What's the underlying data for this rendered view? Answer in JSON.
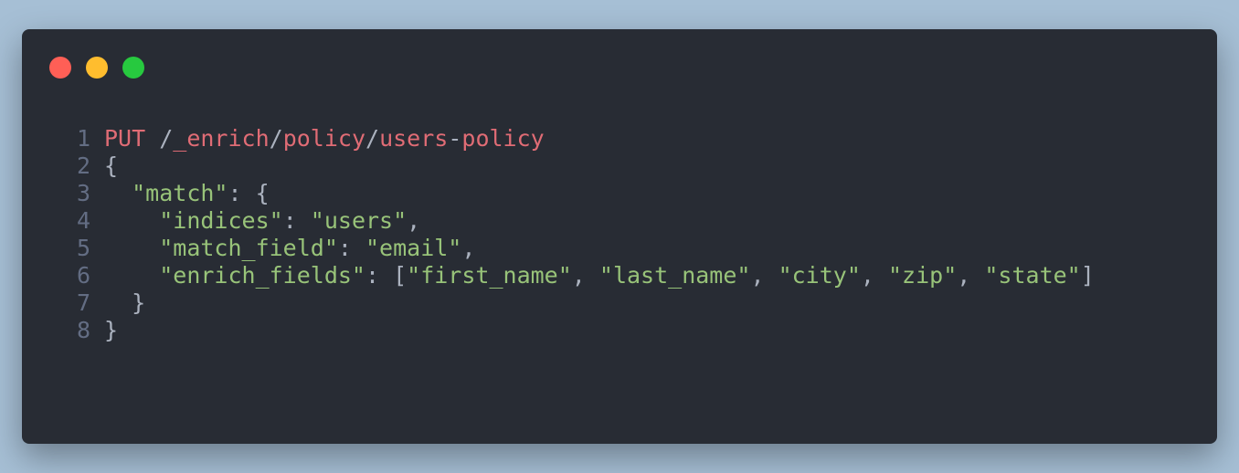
{
  "window_controls": {
    "close": "close",
    "minimize": "minimize",
    "maximize": "maximize"
  },
  "code": {
    "lines": [
      {
        "number": "1",
        "tokens": [
          {
            "text": "PUT",
            "kind": "kw"
          },
          {
            "text": " /",
            "kind": "pl"
          },
          {
            "text": "_enrich",
            "kind": "kw"
          },
          {
            "text": "/",
            "kind": "pl"
          },
          {
            "text": "policy",
            "kind": "kw"
          },
          {
            "text": "/",
            "kind": "pl"
          },
          {
            "text": "users",
            "kind": "kw"
          },
          {
            "text": "-",
            "kind": "pl"
          },
          {
            "text": "policy",
            "kind": "kw"
          }
        ]
      },
      {
        "number": "2",
        "tokens": [
          {
            "text": "{",
            "kind": "pl"
          }
        ]
      },
      {
        "number": "3",
        "tokens": [
          {
            "text": "  ",
            "kind": "pl"
          },
          {
            "text": "\"match\"",
            "kind": "str"
          },
          {
            "text": ": {",
            "kind": "pl"
          }
        ]
      },
      {
        "number": "4",
        "tokens": [
          {
            "text": "    ",
            "kind": "pl"
          },
          {
            "text": "\"indices\"",
            "kind": "str"
          },
          {
            "text": ": ",
            "kind": "pl"
          },
          {
            "text": "\"users\"",
            "kind": "str"
          },
          {
            "text": ",",
            "kind": "pl"
          }
        ]
      },
      {
        "number": "5",
        "tokens": [
          {
            "text": "    ",
            "kind": "pl"
          },
          {
            "text": "\"match_field\"",
            "kind": "str"
          },
          {
            "text": ": ",
            "kind": "pl"
          },
          {
            "text": "\"email\"",
            "kind": "str"
          },
          {
            "text": ",",
            "kind": "pl"
          }
        ]
      },
      {
        "number": "6",
        "tokens": [
          {
            "text": "    ",
            "kind": "pl"
          },
          {
            "text": "\"enrich_fields\"",
            "kind": "str"
          },
          {
            "text": ": [",
            "kind": "pl"
          },
          {
            "text": "\"first_name\"",
            "kind": "str"
          },
          {
            "text": ", ",
            "kind": "pl"
          },
          {
            "text": "\"last_name\"",
            "kind": "str"
          },
          {
            "text": ", ",
            "kind": "pl"
          },
          {
            "text": "\"city\"",
            "kind": "str"
          },
          {
            "text": ", ",
            "kind": "pl"
          },
          {
            "text": "\"zip\"",
            "kind": "str"
          },
          {
            "text": ", ",
            "kind": "pl"
          },
          {
            "text": "\"state\"",
            "kind": "str"
          },
          {
            "text": "]",
            "kind": "pl"
          }
        ]
      },
      {
        "number": "7",
        "tokens": [
          {
            "text": "  }",
            "kind": "pl"
          }
        ]
      },
      {
        "number": "8",
        "tokens": [
          {
            "text": "}",
            "kind": "pl"
          }
        ]
      }
    ]
  }
}
